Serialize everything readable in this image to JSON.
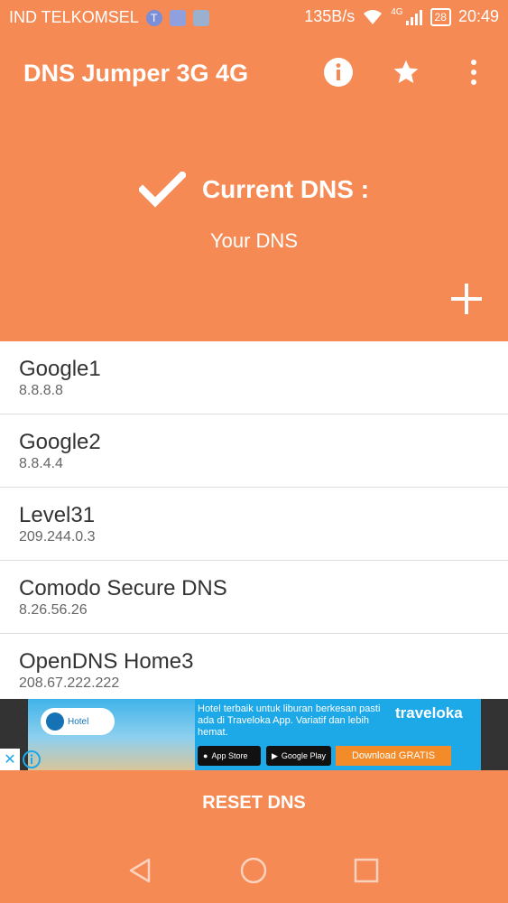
{
  "status_bar": {
    "carrier": "IND TELKOMSEL",
    "notif_letter": "T",
    "net_speed": "135B/s",
    "network_type": "4G",
    "battery": "28",
    "time": "20:49"
  },
  "app_bar": {
    "title": "DNS Jumper 3G 4G"
  },
  "header": {
    "current_label": "Current DNS :",
    "current_value": "Your DNS"
  },
  "dns_list": [
    {
      "name": "Google1",
      "ip": "8.8.8.8"
    },
    {
      "name": "Google2",
      "ip": "8.8.4.4"
    },
    {
      "name": "Level31",
      "ip": "209.244.0.3"
    },
    {
      "name": "Comodo Secure DNS",
      "ip": "8.26.56.26"
    },
    {
      "name": "OpenDNS Home3",
      "ip": "208.67.222.222"
    }
  ],
  "ad": {
    "hotel_badge": "Hotel",
    "text": "Hotel terbaik untuk liburan berkesan pasti ada di Traveloka App. Variatif dan lebih hemat.",
    "brand": "traveloka",
    "app_store": "App Store",
    "google_play": "Google Play",
    "download_label": "Download GRATIS"
  },
  "reset_label": "RESET DNS",
  "colors": {
    "accent": "#f58a54",
    "ad_blue": "#1da8e8"
  }
}
